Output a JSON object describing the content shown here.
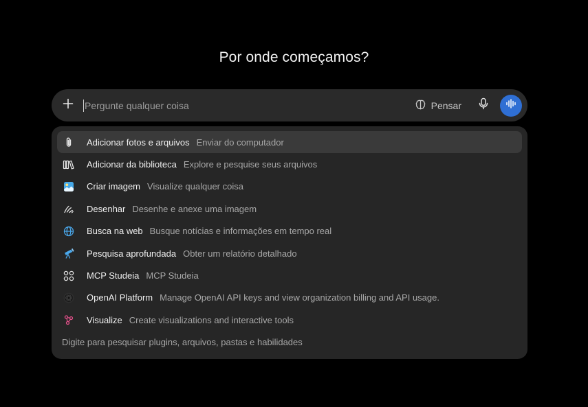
{
  "heading": "Por onde começamos?",
  "composer": {
    "placeholder": "Pergunte qualquer coisa",
    "think_label": "Pensar",
    "voice_accent": "#2f6fd4"
  },
  "menu": {
    "items": [
      {
        "title": "Adicionar fotos e arquivos",
        "desc": "Enviar do computador",
        "icon": "paperclip-icon"
      },
      {
        "title": "Adicionar da biblioteca",
        "desc": "Explore e pesquise seus arquivos",
        "icon": "library-icon"
      },
      {
        "title": "Criar imagem",
        "desc": "Visualize qualquer coisa",
        "icon": "image-icon"
      },
      {
        "title": "Desenhar",
        "desc": "Desenhe e anexe uma imagem",
        "icon": "draw-icon"
      },
      {
        "title": "Busca na web",
        "desc": "Busque notícias e informações em tempo real",
        "icon": "globe-icon"
      },
      {
        "title": "Pesquisa aprofundada",
        "desc": "Obter um relatório detalhado",
        "icon": "telescope-icon"
      },
      {
        "title": "MCP Studeia",
        "desc": "MCP Studeia",
        "icon": "apps-grid-icon"
      },
      {
        "title": "OpenAI Platform",
        "desc": "Manage OpenAI API keys and view organization billing and API usage.",
        "icon": "openai-icon"
      },
      {
        "title": "Visualize",
        "desc": "Create visualizations and interactive tools",
        "icon": "visualize-icon"
      }
    ],
    "footer": "Digite para pesquisar plugins, arquivos, pastas e habilidades"
  }
}
